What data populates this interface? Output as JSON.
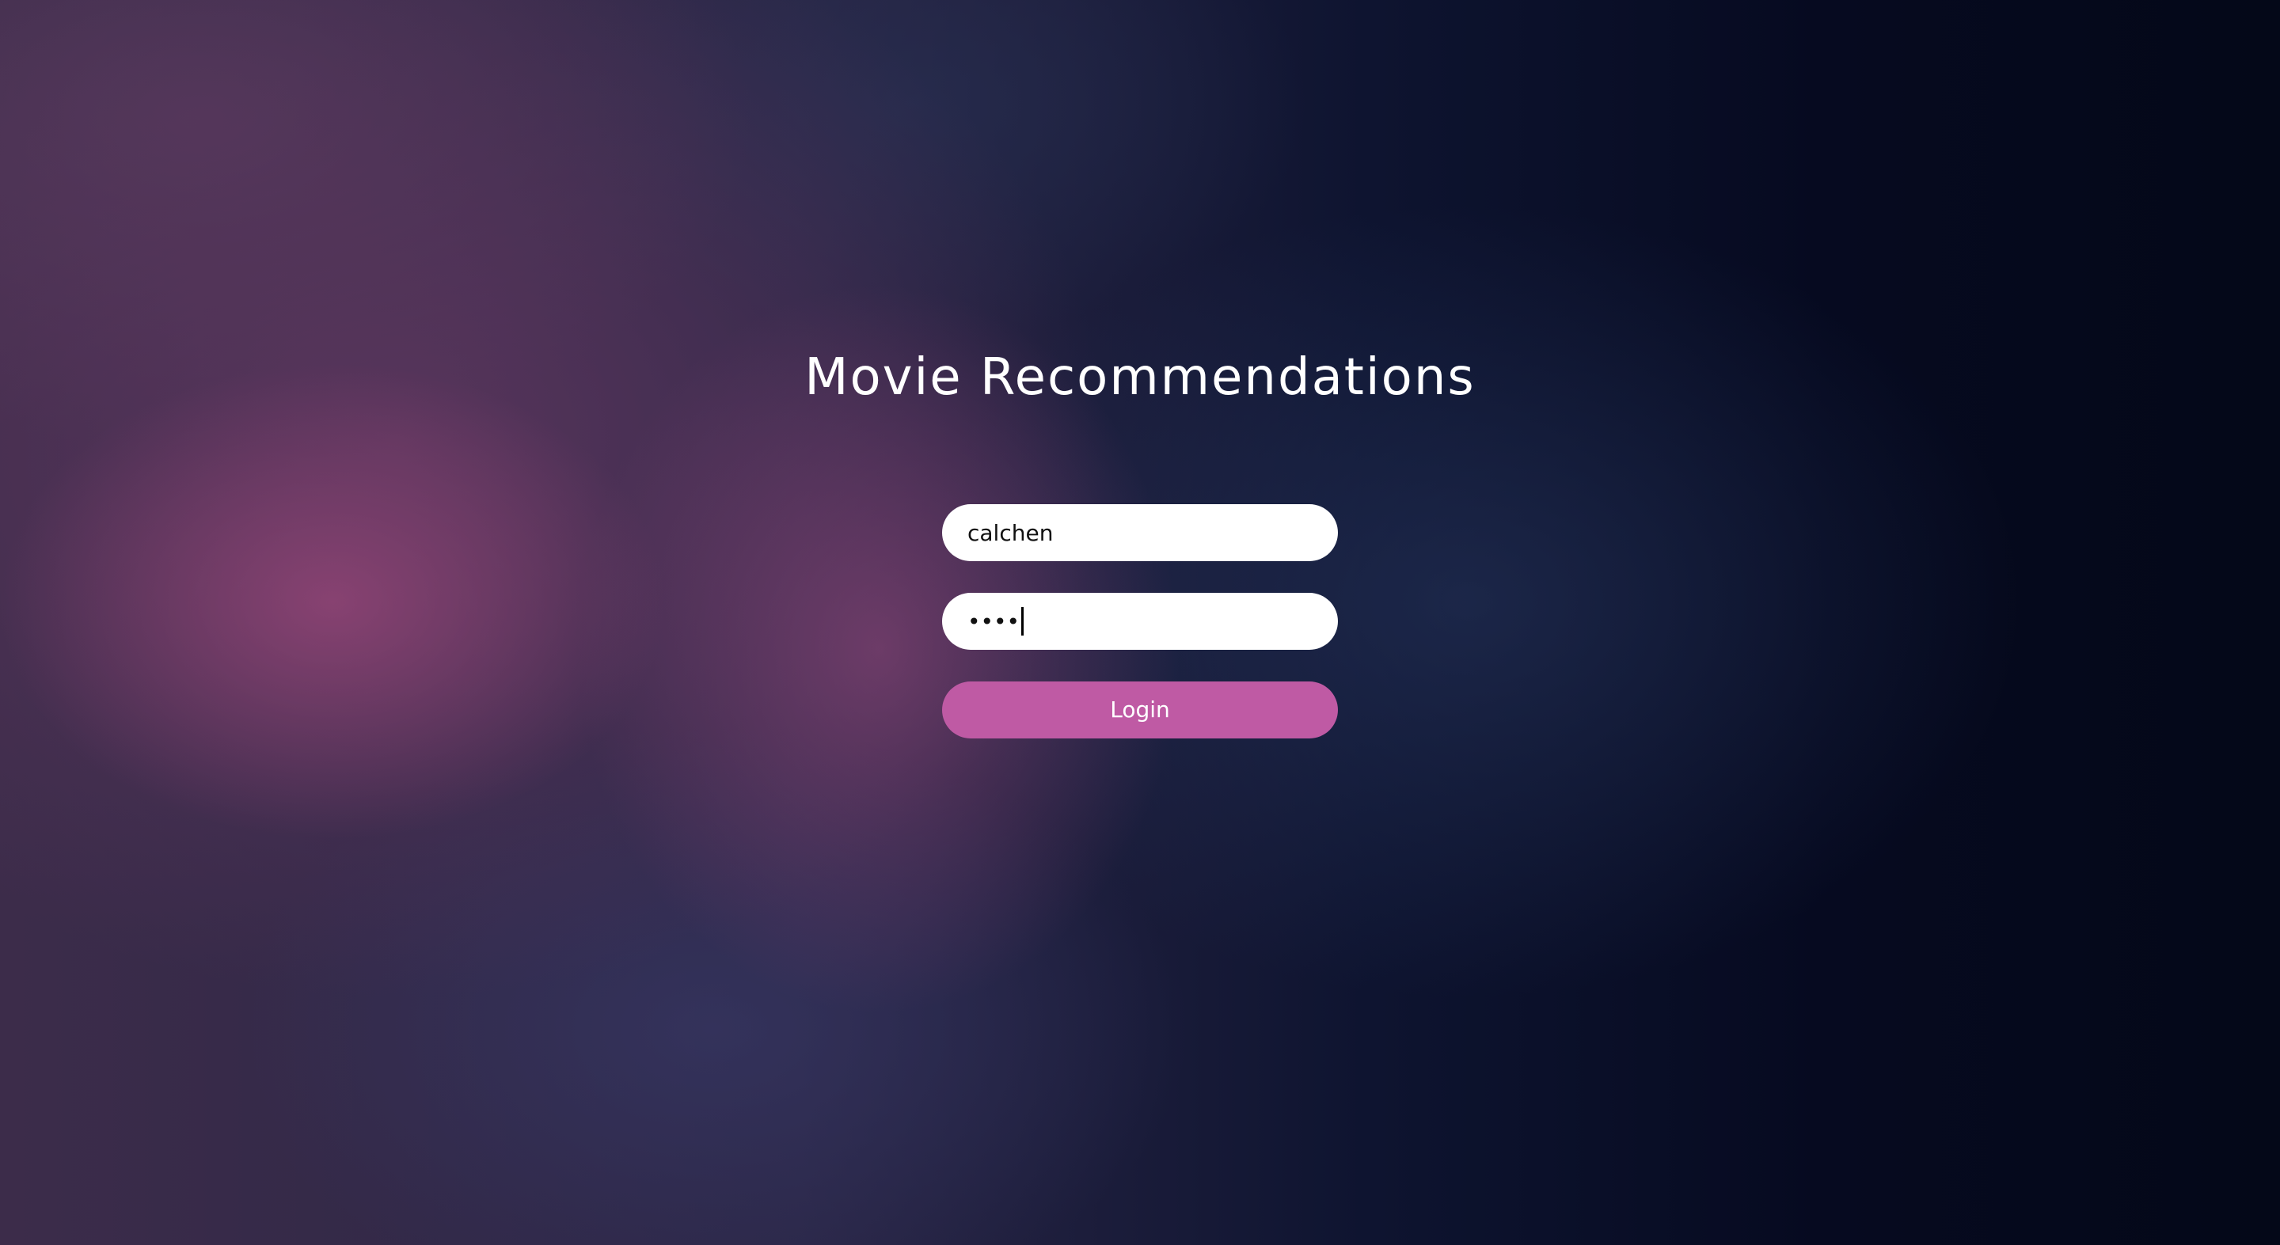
{
  "app": {
    "title": "Movie Recommendations"
  },
  "login_form": {
    "username_value": "calchen",
    "password_value": "••••",
    "login_label": "Login"
  },
  "colors": {
    "button": "#bf5aa4",
    "field_background": "#ffffff",
    "title_text": "#ffffff"
  }
}
